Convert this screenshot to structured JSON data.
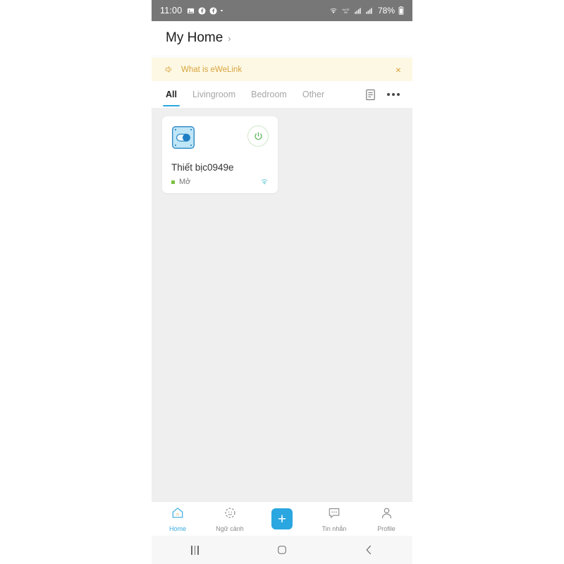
{
  "status_bar": {
    "time": "11:00",
    "battery": "78%",
    "left_icons": [
      "image-icon",
      "facebook-icon",
      "facebook-icon",
      "dot-icon"
    ],
    "right_icons": [
      "wifi-icon",
      "volte-icon",
      "signal-icon",
      "signal-icon",
      "battery-icon"
    ],
    "background_color": "#777777"
  },
  "header": {
    "title": "My Home",
    "chevron": "›"
  },
  "banner": {
    "icon": "speaker-icon",
    "text": "What is eWeLink",
    "close": "×",
    "background_color": "#fdf8e3",
    "text_color": "#d9a441"
  },
  "tabs": {
    "items": [
      {
        "label": "All",
        "active": true
      },
      {
        "label": "Livingroom",
        "active": false
      },
      {
        "label": "Bedroom",
        "active": false
      },
      {
        "label": "Other",
        "active": false
      }
    ],
    "list_icon": "list-view-icon",
    "more_icon": "more-options-icon",
    "active_color": "#2aa6e0"
  },
  "devices": [
    {
      "icon": "smart-switch-icon",
      "name": "Thiết bịc0949e",
      "status": "Mở",
      "status_color": "#7bc043",
      "power_state": "on",
      "power_icon": "power-icon",
      "connection_icon": "wifi-icon"
    }
  ],
  "bottom_nav": [
    {
      "label": "Home",
      "icon": "home-icon",
      "active": true
    },
    {
      "label": "Ngữ cảnh",
      "icon": "scene-icon",
      "active": false
    },
    {
      "label": "",
      "icon": "add-icon",
      "active": false,
      "is_add": true
    },
    {
      "label": "Tin nhắn",
      "icon": "message-icon",
      "active": false
    },
    {
      "label": "Profile",
      "icon": "profile-icon",
      "active": false
    }
  ],
  "android_nav": {
    "recents": "recents-icon",
    "home": "android-home-icon",
    "back": "back-icon"
  }
}
